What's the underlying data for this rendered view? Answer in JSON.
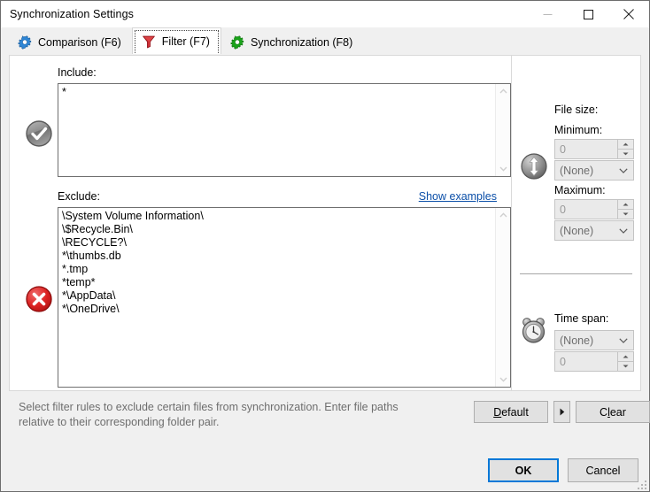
{
  "window": {
    "title": "Synchronization Settings",
    "controls": {
      "minimize": "minimize-icon",
      "maximize": "maximize-icon",
      "close": "close-icon"
    }
  },
  "tabs": [
    {
      "id": "comparison",
      "label": "Comparison (F6)",
      "icon": "blue-gear-icon",
      "selected": false
    },
    {
      "id": "filter",
      "label": "Filter (F7)",
      "icon": "red-funnel-icon",
      "selected": true
    },
    {
      "id": "synchronization",
      "label": "Synchronization (F8)",
      "icon": "green-gear-icon",
      "selected": false
    }
  ],
  "filter": {
    "include": {
      "icon": "grey-check-circle-icon",
      "label": "Include:",
      "value": "*"
    },
    "exclude": {
      "icon": "red-x-circle-icon",
      "label": "Exclude:",
      "show_examples_link": "Show examples",
      "value": "\\System Volume Information\\\n\\$Recycle.Bin\\\n\\RECYCLE?\\\n*\\thumbs.db\n*.tmp\n*temp*\n*\\AppData\\\n*\\OneDrive\\"
    }
  },
  "file_size": {
    "icon": "grey-up-down-arrow-icon",
    "heading": "File size:",
    "minimum": {
      "label": "Minimum:",
      "value": "0",
      "unit": "(None)"
    },
    "maximum": {
      "label": "Maximum:",
      "value": "0",
      "unit": "(None)"
    }
  },
  "time_span": {
    "icon": "alarm-clock-icon",
    "heading": "Time span:",
    "unit": "(None)",
    "value": "0"
  },
  "hint": "Select filter rules to exclude certain files from synchronization. Enter file paths relative to their corresponding folder pair.",
  "buttons": {
    "default": {
      "prefix": "",
      "accel": "D",
      "rest": "efault"
    },
    "default_dropdown": "▶",
    "clear": {
      "prefix": "C",
      "accel": "l",
      "rest": "ear"
    },
    "ok": "OK",
    "cancel": "Cancel"
  },
  "colors": {
    "accent": "#0078d7",
    "link": "#0b4fa8",
    "window_bg": "#f0f0f0",
    "panel_bg": "#ffffff",
    "hint_text": "#6e6e6e"
  }
}
